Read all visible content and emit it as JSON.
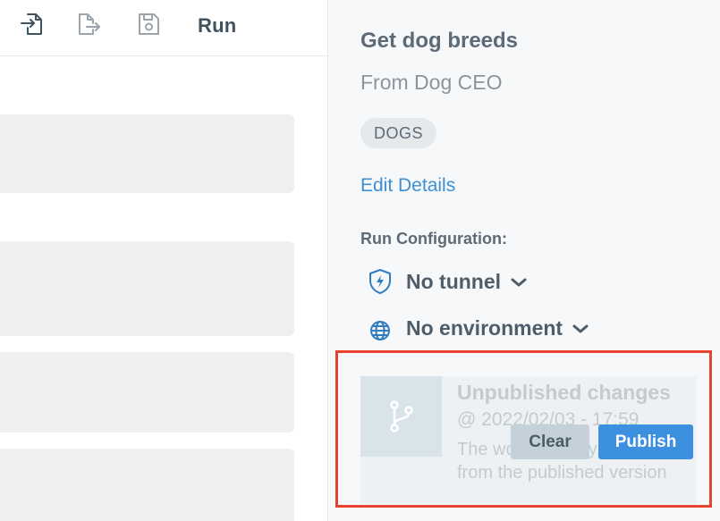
{
  "toolbar": {
    "icons": [
      "file-import-icon",
      "file-export-icon",
      "save-icon"
    ],
    "run_label": "Run"
  },
  "details": {
    "title": "Get dog breeds",
    "subtitle": "From Dog CEO",
    "tag": "DOGS",
    "edit_link": "Edit Details"
  },
  "run_config": {
    "label": "Run Configuration:",
    "tunnel": {
      "icon": "shield-bolt-icon",
      "label": "No tunnel"
    },
    "environment": {
      "icon": "globe-icon",
      "label": "No environment"
    }
  },
  "unpublished": {
    "icon": "git-branch-icon",
    "title": "Unpublished changes",
    "timestamp": "@ 2022/02/03 - 17:59",
    "description": "The working copy differs from the published version",
    "clear_label": "Clear",
    "publish_label": "Publish"
  },
  "colors": {
    "accent": "#3d8fe0",
    "link": "#3d8fd1",
    "highlight": "#e8432e"
  }
}
